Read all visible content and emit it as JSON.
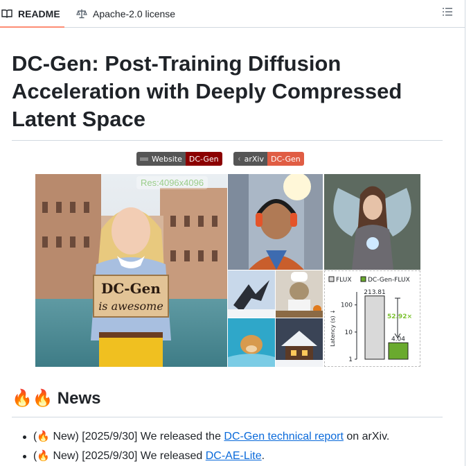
{
  "tabs": {
    "readme_label": "README",
    "license_label": "Apache-2.0 license"
  },
  "readme": {
    "title": "DC-Gen: Post-Training Diffusion Acceleration with Deeply Compressed Latent Space",
    "badges": [
      {
        "left": "Website",
        "right": "DC-Gen"
      },
      {
        "left": "arXiv",
        "right": "DC-Gen"
      }
    ],
    "hero": {
      "resolution_label": "Res:4096x4096",
      "sign_text_1": "DC-Gen",
      "sign_text_2": "is awesome"
    },
    "news_heading": "News",
    "news_emoji": "🔥🔥",
    "news": [
      {
        "prefix": "(",
        "emoji": "🔥",
        "text_before": " New) [2025/9/30] We released the ",
        "link": "DC-Gen technical report",
        "text_after": " on arXiv."
      },
      {
        "prefix": "(",
        "emoji": "🔥",
        "text_before": " New) [2025/9/30] We released ",
        "link": "DC-AE-Lite",
        "text_after": "."
      }
    ]
  },
  "chart_data": {
    "type": "bar",
    "categories": [
      "FLUX",
      "DC-Gen-FLUX"
    ],
    "series": [
      {
        "name": "FLUX",
        "values": [
          213.81
        ]
      },
      {
        "name": "DC-Gen-FLUX",
        "values": [
          4.04
        ]
      }
    ],
    "values": [
      213.81,
      4.04
    ],
    "ylabel": "Latency (s) ↓",
    "yscale": "log",
    "yticks": [
      "1",
      "10",
      "100"
    ],
    "speedup_label": "52.92×",
    "colors": {
      "FLUX": "#d9d9d9",
      "DC-Gen-FLUX": "#6aaa2e",
      "speedup": "#7cc230"
    }
  },
  "colors": {
    "accent": "#fd8c73",
    "link": "#0969da",
    "border": "#d1d9e0"
  }
}
